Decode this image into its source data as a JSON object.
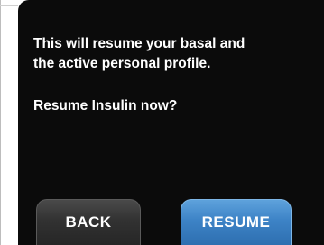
{
  "dialog": {
    "message_lines": [
      "This will resume your basal and",
      "the active personal profile."
    ],
    "question": "Resume Insulin now?"
  },
  "buttons": {
    "back_label": "BACK",
    "resume_label": "RESUME"
  },
  "colors": {
    "screen_background": "#0b0b0b",
    "text": "#ffffff",
    "back_button": "#333333",
    "resume_button": "#3d83c6"
  }
}
